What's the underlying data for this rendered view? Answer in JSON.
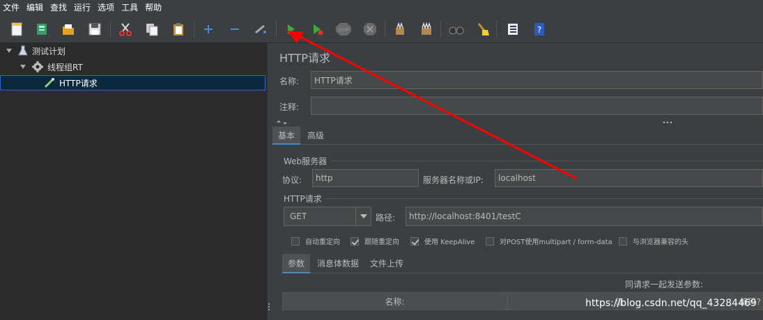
{
  "menu": [
    "文件",
    "编辑",
    "查找",
    "运行",
    "选项",
    "工具",
    "帮助"
  ],
  "toolbar_icons": [
    "new-icon",
    "templates-icon",
    "open-icon",
    "save-icon",
    "cut-icon",
    "copy-icon",
    "paste-icon",
    "expand-icon",
    "collapse-icon",
    "toggle-icon",
    "start-icon",
    "start-no-pause-icon",
    "stop-icon",
    "shutdown-icon",
    "clear-icon",
    "clear-all-icon",
    "search-icon",
    "reset-search-icon",
    "function-helper-icon",
    "help-icon"
  ],
  "tree": {
    "plan": "测试计划",
    "thread_group": "线程组RT",
    "sampler": "HTTP请求"
  },
  "panel": {
    "title": "HTTP请求",
    "name_label": "名称:",
    "name_value": "HTTP请求",
    "comment_label": "注释:",
    "comment_value": "",
    "tabs": [
      "基本",
      "高级"
    ],
    "web_server_group": "Web服务器",
    "protocol_label": "协议:",
    "protocol_value": "http",
    "server_label": "服务器名称或IP:",
    "server_value": "localhost",
    "http_group": "HTTP请求",
    "method_value": "GET",
    "path_label": "路径:",
    "path_value": "http://localhost:8401/testC",
    "options": [
      {
        "label": "自动重定向",
        "checked": false
      },
      {
        "label": "跟随重定向",
        "checked": true
      },
      {
        "label": "使用 KeepAlive",
        "checked": true
      },
      {
        "label": "对POST使用multipart / form-data",
        "checked": false
      },
      {
        "label": "与浏览器兼容的头",
        "checked": false
      }
    ],
    "sub_tabs": [
      "参数",
      "消息体数据",
      "文件上传"
    ],
    "send_params_label": "同请求一起发送参数:",
    "col_name": "名称:",
    "col_value": "值",
    "col_encode": "编码?"
  },
  "watermark": "https://blog.csdn.net/qq_43284469",
  "colors": {
    "accent": "#4a88c7",
    "annotation_arrow": "#ff0000",
    "selection": "#0d293e"
  }
}
